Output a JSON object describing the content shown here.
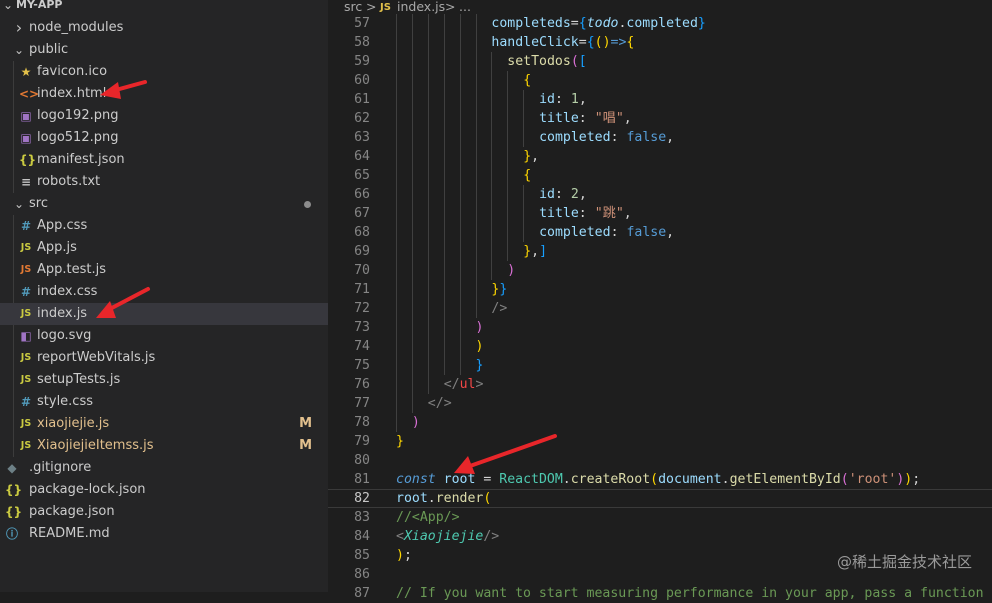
{
  "explorer": {
    "project_title": "MY-APP",
    "items": [
      {
        "name": "node_modules",
        "kind": "folder",
        "expanded": false,
        "icon": "chevron-right-icon"
      },
      {
        "name": "public",
        "kind": "folder",
        "expanded": true,
        "icon": "chevron-down-icon"
      },
      {
        "name": "favicon.ico",
        "kind": "file",
        "icon": "star-icon",
        "icon_glyph": "★",
        "icon_color": "#e2c04a"
      },
      {
        "name": "index.html",
        "kind": "file",
        "icon": "html-file-icon",
        "icon_glyph": "<>",
        "icon_color": "#e37933"
      },
      {
        "name": "logo192.png",
        "kind": "file",
        "icon": "image-file-icon",
        "icon_glyph": "▣",
        "icon_color": "#a074c4"
      },
      {
        "name": "logo512.png",
        "kind": "file",
        "icon": "image-file-icon",
        "icon_glyph": "▣",
        "icon_color": "#a074c4"
      },
      {
        "name": "manifest.json",
        "kind": "file",
        "icon": "json-file-icon",
        "icon_glyph": "{}",
        "icon_color": "#cbcb41"
      },
      {
        "name": "robots.txt",
        "kind": "file",
        "icon": "text-file-icon",
        "icon_glyph": "≡",
        "icon_color": "#c5c5c5"
      },
      {
        "name": "src",
        "kind": "folder",
        "expanded": true,
        "icon": "chevron-down-icon",
        "modified_dot": true
      },
      {
        "name": "App.css",
        "kind": "file",
        "icon": "css-file-icon",
        "icon_glyph": "#",
        "icon_color": "#519aba"
      },
      {
        "name": "App.js",
        "kind": "file",
        "icon": "js-file-icon",
        "icon_glyph": "JS",
        "icon_color": "#cbcb41"
      },
      {
        "name": "App.test.js",
        "kind": "file",
        "icon": "test-js-file-icon",
        "icon_glyph": "JS",
        "icon_color": "#e37933"
      },
      {
        "name": "index.css",
        "kind": "file",
        "icon": "css-file-icon",
        "icon_glyph": "#",
        "icon_color": "#519aba"
      },
      {
        "name": "index.js",
        "kind": "file",
        "icon": "js-file-icon",
        "icon_glyph": "JS",
        "icon_color": "#cbcb41",
        "selected": true
      },
      {
        "name": "logo.svg",
        "kind": "file",
        "icon": "svg-file-icon",
        "icon_glyph": "◧",
        "icon_color": "#a074c4"
      },
      {
        "name": "reportWebVitals.js",
        "kind": "file",
        "icon": "js-file-icon",
        "icon_glyph": "JS",
        "icon_color": "#cbcb41"
      },
      {
        "name": "setupTests.js",
        "kind": "file",
        "icon": "js-file-icon",
        "icon_glyph": "JS",
        "icon_color": "#cbcb41"
      },
      {
        "name": "style.css",
        "kind": "file",
        "icon": "css-file-icon",
        "icon_glyph": "#",
        "icon_color": "#519aba"
      },
      {
        "name": "xiaojiejie.js",
        "kind": "file",
        "icon": "js-file-icon",
        "icon_glyph": "JS",
        "icon_color": "#cbcb41",
        "status": "M",
        "name_color": "#e2c08d"
      },
      {
        "name": "XiaojiejieItemss.js",
        "kind": "file",
        "icon": "js-file-icon",
        "icon_glyph": "JS",
        "icon_color": "#cbcb41",
        "status": "M",
        "name_color": "#e2c08d"
      },
      {
        "name": ".gitignore",
        "kind": "file",
        "icon": "git-file-icon",
        "icon_glyph": "◆",
        "icon_color": "#6d8086"
      },
      {
        "name": "package-lock.json",
        "kind": "file",
        "icon": "json-file-icon",
        "icon_glyph": "{}",
        "icon_color": "#cbcb41"
      },
      {
        "name": "package.json",
        "kind": "file",
        "icon": "json-file-icon",
        "icon_glyph": "{}",
        "icon_color": "#cbcb41"
      },
      {
        "name": "README.md",
        "kind": "file",
        "icon": "info-file-icon",
        "icon_glyph": "ⓘ",
        "icon_color": "#519aba"
      }
    ]
  },
  "breadcrumb": {
    "folder": "src",
    "sep1": ">",
    "file_badge": "JS",
    "file": "index.js",
    "sep2": ">",
    "ellipsis": "..."
  },
  "editor": {
    "active_line": 82,
    "lines": [
      {
        "n": 57,
        "tokens": [
          [
            "attr",
            "completeds"
          ],
          [
            "eq",
            "="
          ],
          [
            "b3",
            "{"
          ],
          [
            "ivar",
            "todo"
          ],
          [
            "plain",
            "."
          ],
          [
            "var",
            "completed"
          ],
          [
            "b3",
            "}"
          ]
        ]
      },
      {
        "n": 58,
        "tokens": [
          [
            "attr",
            "handleClick"
          ],
          [
            "eq",
            "="
          ],
          [
            "b3",
            "{"
          ],
          [
            "b1",
            "()"
          ],
          [
            "kw",
            "=>"
          ],
          [
            "b1",
            "{"
          ]
        ]
      },
      {
        "n": 59,
        "tokens": [
          [
            "fn",
            "setTodos"
          ],
          [
            "b2",
            "("
          ],
          [
            "b3",
            "["
          ]
        ]
      },
      {
        "n": 60,
        "tokens": [
          [
            "b1",
            "{"
          ]
        ]
      },
      {
        "n": 61,
        "tokens": [
          [
            "var",
            "id"
          ],
          [
            "plain",
            ": "
          ],
          [
            "num",
            "1"
          ],
          [
            "plain",
            ","
          ]
        ]
      },
      {
        "n": 62,
        "tokens": [
          [
            "var",
            "title"
          ],
          [
            "plain",
            ": "
          ],
          [
            "str",
            "\"唱\""
          ],
          [
            "plain",
            ","
          ]
        ]
      },
      {
        "n": 63,
        "tokens": [
          [
            "var",
            "completed"
          ],
          [
            "plain",
            ": "
          ],
          [
            "kw",
            "false"
          ],
          [
            "plain",
            ","
          ]
        ]
      },
      {
        "n": 64,
        "tokens": [
          [
            "b1",
            "}"
          ],
          [
            "plain",
            ","
          ]
        ]
      },
      {
        "n": 65,
        "tokens": [
          [
            "b1",
            "{"
          ]
        ]
      },
      {
        "n": 66,
        "tokens": [
          [
            "var",
            "id"
          ],
          [
            "plain",
            ": "
          ],
          [
            "num",
            "2"
          ],
          [
            "plain",
            ","
          ]
        ]
      },
      {
        "n": 67,
        "tokens": [
          [
            "var",
            "title"
          ],
          [
            "plain",
            ": "
          ],
          [
            "str",
            "\"跳\""
          ],
          [
            "plain",
            ","
          ]
        ]
      },
      {
        "n": 68,
        "tokens": [
          [
            "var",
            "completed"
          ],
          [
            "plain",
            ": "
          ],
          [
            "kw",
            "false"
          ],
          [
            "plain",
            ","
          ]
        ]
      },
      {
        "n": 69,
        "tokens": [
          [
            "b1",
            "}"
          ],
          [
            "plain",
            ","
          ],
          [
            "b3",
            "]"
          ]
        ]
      },
      {
        "n": 70,
        "tokens": [
          [
            "b2",
            ")"
          ]
        ]
      },
      {
        "n": 71,
        "tokens": [
          [
            "b1",
            "}"
          ],
          [
            "b3",
            "}"
          ]
        ]
      },
      {
        "n": 72,
        "tokens": [
          [
            "tag",
            "/>"
          ]
        ]
      },
      {
        "n": 73,
        "tokens": [
          [
            "b2",
            ")"
          ]
        ]
      },
      {
        "n": 74,
        "tokens": [
          [
            "b1",
            ")"
          ]
        ]
      },
      {
        "n": 75,
        "tokens": [
          [
            "b3",
            "}"
          ]
        ]
      },
      {
        "n": 76,
        "tokens": [
          [
            "tag",
            "</"
          ],
          [
            "red",
            "ul"
          ],
          [
            "tag",
            ">"
          ]
        ]
      },
      {
        "n": 77,
        "tokens": [
          [
            "tag",
            "</"
          ],
          [
            "tag",
            ">"
          ]
        ]
      },
      {
        "n": 78,
        "tokens": [
          [
            "b2",
            ")"
          ]
        ]
      },
      {
        "n": 79,
        "tokens": [
          [
            "b1",
            "}"
          ]
        ]
      },
      {
        "n": 80,
        "tokens": []
      },
      {
        "n": 81,
        "tokens": [
          [
            "ikw",
            "const"
          ],
          [
            "plain",
            " "
          ],
          [
            "var",
            "root"
          ],
          [
            "plain",
            " = "
          ],
          [
            "cls",
            "ReactDOM"
          ],
          [
            "plain",
            "."
          ],
          [
            "fn",
            "createRoot"
          ],
          [
            "b1",
            "("
          ],
          [
            "var",
            "document"
          ],
          [
            "plain",
            "."
          ],
          [
            "fn",
            "getElementById"
          ],
          [
            "b2",
            "("
          ],
          [
            "str",
            "'root'"
          ],
          [
            "b2",
            ")"
          ],
          [
            "b1",
            ")"
          ],
          [
            "plain",
            ";"
          ]
        ]
      },
      {
        "n": 82,
        "tokens": [
          [
            "var",
            "root"
          ],
          [
            "plain",
            "."
          ],
          [
            "fn",
            "render"
          ],
          [
            "b1",
            "("
          ]
        ]
      },
      {
        "n": 83,
        "tokens": [
          [
            "com",
            "//<App/>"
          ]
        ]
      },
      {
        "n": 84,
        "tokens": [
          [
            "tag",
            "<"
          ],
          [
            "comp",
            "Xiaojiejie"
          ],
          [
            "tag",
            "/>"
          ]
        ]
      },
      {
        "n": 85,
        "tokens": [
          [
            "b1",
            ")"
          ],
          [
            "plain",
            ";"
          ]
        ]
      },
      {
        "n": 86,
        "tokens": []
      },
      {
        "n": 87,
        "tokens": [
          [
            "com",
            "// If you want to start measuring performance in your app, pass a function"
          ]
        ]
      }
    ]
  },
  "watermark": "@稀土掘金技术社区",
  "colors": {
    "annotation_arrow": "#e8262a",
    "selection": "#37373d",
    "modified": "#e2c08d"
  }
}
